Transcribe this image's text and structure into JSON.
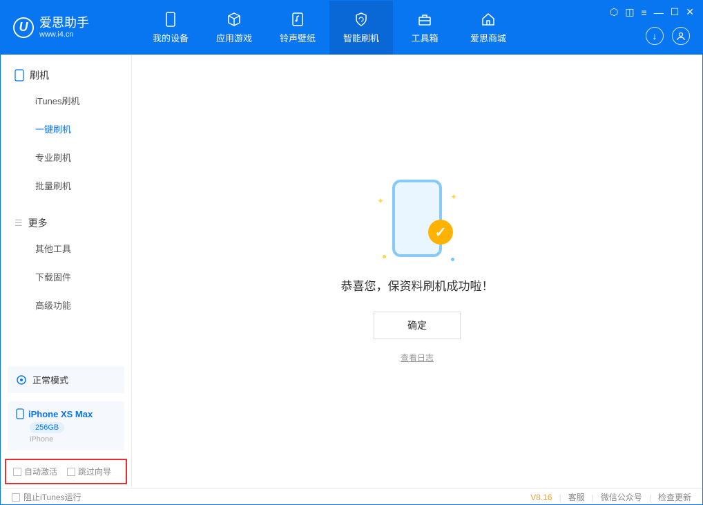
{
  "app": {
    "name": "爱思助手",
    "url": "www.i4.cn"
  },
  "nav": [
    {
      "label": "我的设备",
      "icon": "device"
    },
    {
      "label": "应用游戏",
      "icon": "cube"
    },
    {
      "label": "铃声壁纸",
      "icon": "music"
    },
    {
      "label": "智能刷机",
      "icon": "shield",
      "active": true
    },
    {
      "label": "工具箱",
      "icon": "toolbox"
    },
    {
      "label": "爱思商城",
      "icon": "home"
    }
  ],
  "sidebar": {
    "section1_title": "刷机",
    "section1_items": [
      "iTunes刷机",
      "一键刷机",
      "专业刷机",
      "批量刷机"
    ],
    "section1_active_index": 1,
    "section2_title": "更多",
    "section2_items": [
      "其他工具",
      "下载固件",
      "高级功能"
    ]
  },
  "mode": {
    "label": "正常模式"
  },
  "device": {
    "name": "iPhone XS Max",
    "storage": "256GB",
    "type": "iPhone"
  },
  "checkboxes": {
    "auto_activate": "自动激活",
    "skip_guide": "跳过向导"
  },
  "main": {
    "success_text": "恭喜您，保资料刷机成功啦！",
    "ok_button": "确定",
    "view_log": "查看日志"
  },
  "footer": {
    "block_itunes": "阻止iTunes运行",
    "version": "V8.16",
    "links": [
      "客服",
      "微信公众号",
      "检查更新"
    ]
  }
}
